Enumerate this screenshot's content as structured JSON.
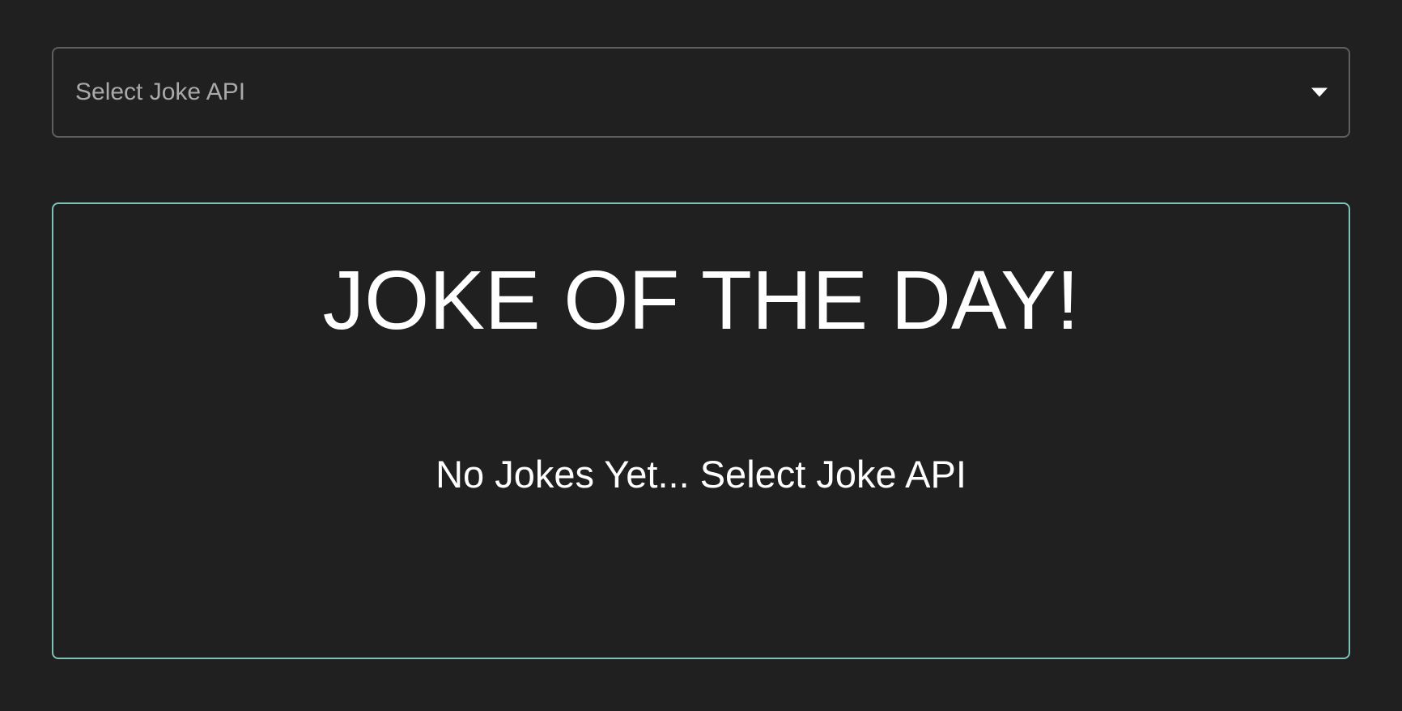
{
  "joke_api_select": {
    "placeholder": "Select Joke API",
    "selected_value": "",
    "arrow_icon": "caret-down-icon"
  },
  "joke_card": {
    "title": "JOKE OF THE DAY!",
    "joke_text": "No Jokes Yet... Select Joke API"
  },
  "colors": {
    "background": "#202020",
    "select_border": "#5f5f5f",
    "card_border": "#7cc2b5",
    "placeholder_text": "#a9a9a9",
    "text": "#ffffff"
  }
}
